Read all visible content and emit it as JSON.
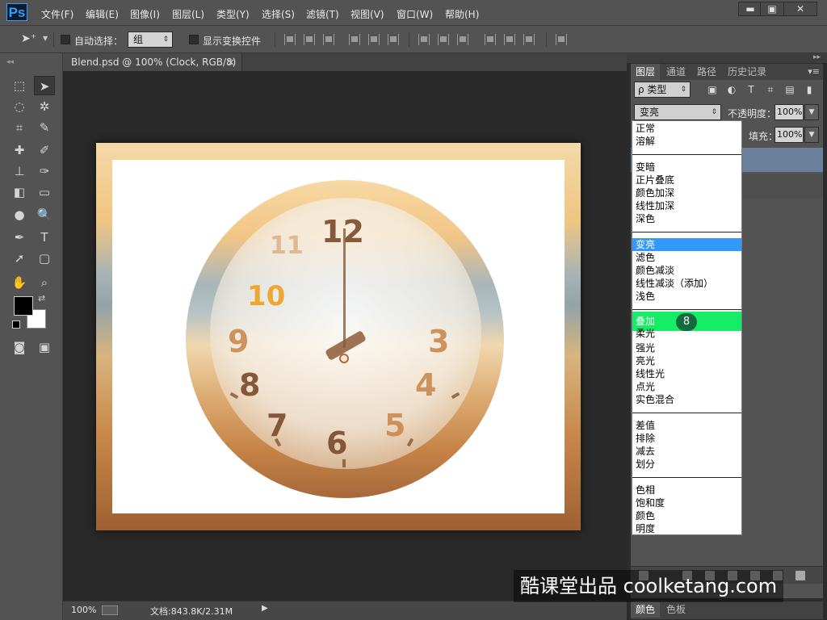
{
  "app": {
    "logo": "Ps"
  },
  "menu": [
    "文件(F)",
    "编辑(E)",
    "图像(I)",
    "图层(L)",
    "类型(Y)",
    "选择(S)",
    "滤镜(T)",
    "视图(V)",
    "窗口(W)",
    "帮助(H)"
  ],
  "window_controls": {
    "minimize": "▬",
    "maximize": "▣",
    "close": "✕"
  },
  "options_bar": {
    "auto_select_label": "自动选择：",
    "auto_select_value": "组",
    "show_transform_label": "显示变换控件"
  },
  "document": {
    "tab_title": "Blend.psd @ 100% (Clock, RGB/8) *",
    "tab_close": "×",
    "zoom": "100%",
    "doc_size": "文档:843.8K/2.31M"
  },
  "clock": {
    "numerals": {
      "n12": "12",
      "n3": "3",
      "n4": "4",
      "n5": "5",
      "n6": "6",
      "n7": "7",
      "n8": "8",
      "n9": "9",
      "n11": "11"
    }
  },
  "layers_panel": {
    "tabs": [
      "图层",
      "通道",
      "路径",
      "历史记录"
    ],
    "filter_label": "ρ 类型",
    "blend_mode": "变亮",
    "opacity_label": "不透明度：",
    "opacity_value": "100%",
    "fill_label": "填充：",
    "fill_value": "100%"
  },
  "blend_modes": {
    "group1": [
      "正常",
      "溶解"
    ],
    "group2": [
      "变暗",
      "正片叠底",
      "颜色加深",
      "线性加深",
      "深色"
    ],
    "group3": [
      "变亮",
      "滤色",
      "颜色减淡",
      "线性减淡（添加）",
      "浅色"
    ],
    "group4": [
      "叠加",
      "柔光",
      "强光",
      "亮光",
      "线性光",
      "点光",
      "实色混合"
    ],
    "group5": [
      "差值",
      "排除",
      "减去",
      "划分"
    ],
    "group6": [
      "色相",
      "饱和度",
      "颜色",
      "明度"
    ],
    "selected": "变亮",
    "highlighted": "叠加",
    "step_badge": "8"
  },
  "color_panel": {
    "tabs": [
      "颜色",
      "色板"
    ]
  },
  "watermark": "酷课堂出品 coolketang.com",
  "colors": {
    "accent_select": "#3399ff",
    "highlight": "#17ec66",
    "badge": "#156b3e",
    "foreground": "#000000",
    "background": "#ffffff"
  }
}
